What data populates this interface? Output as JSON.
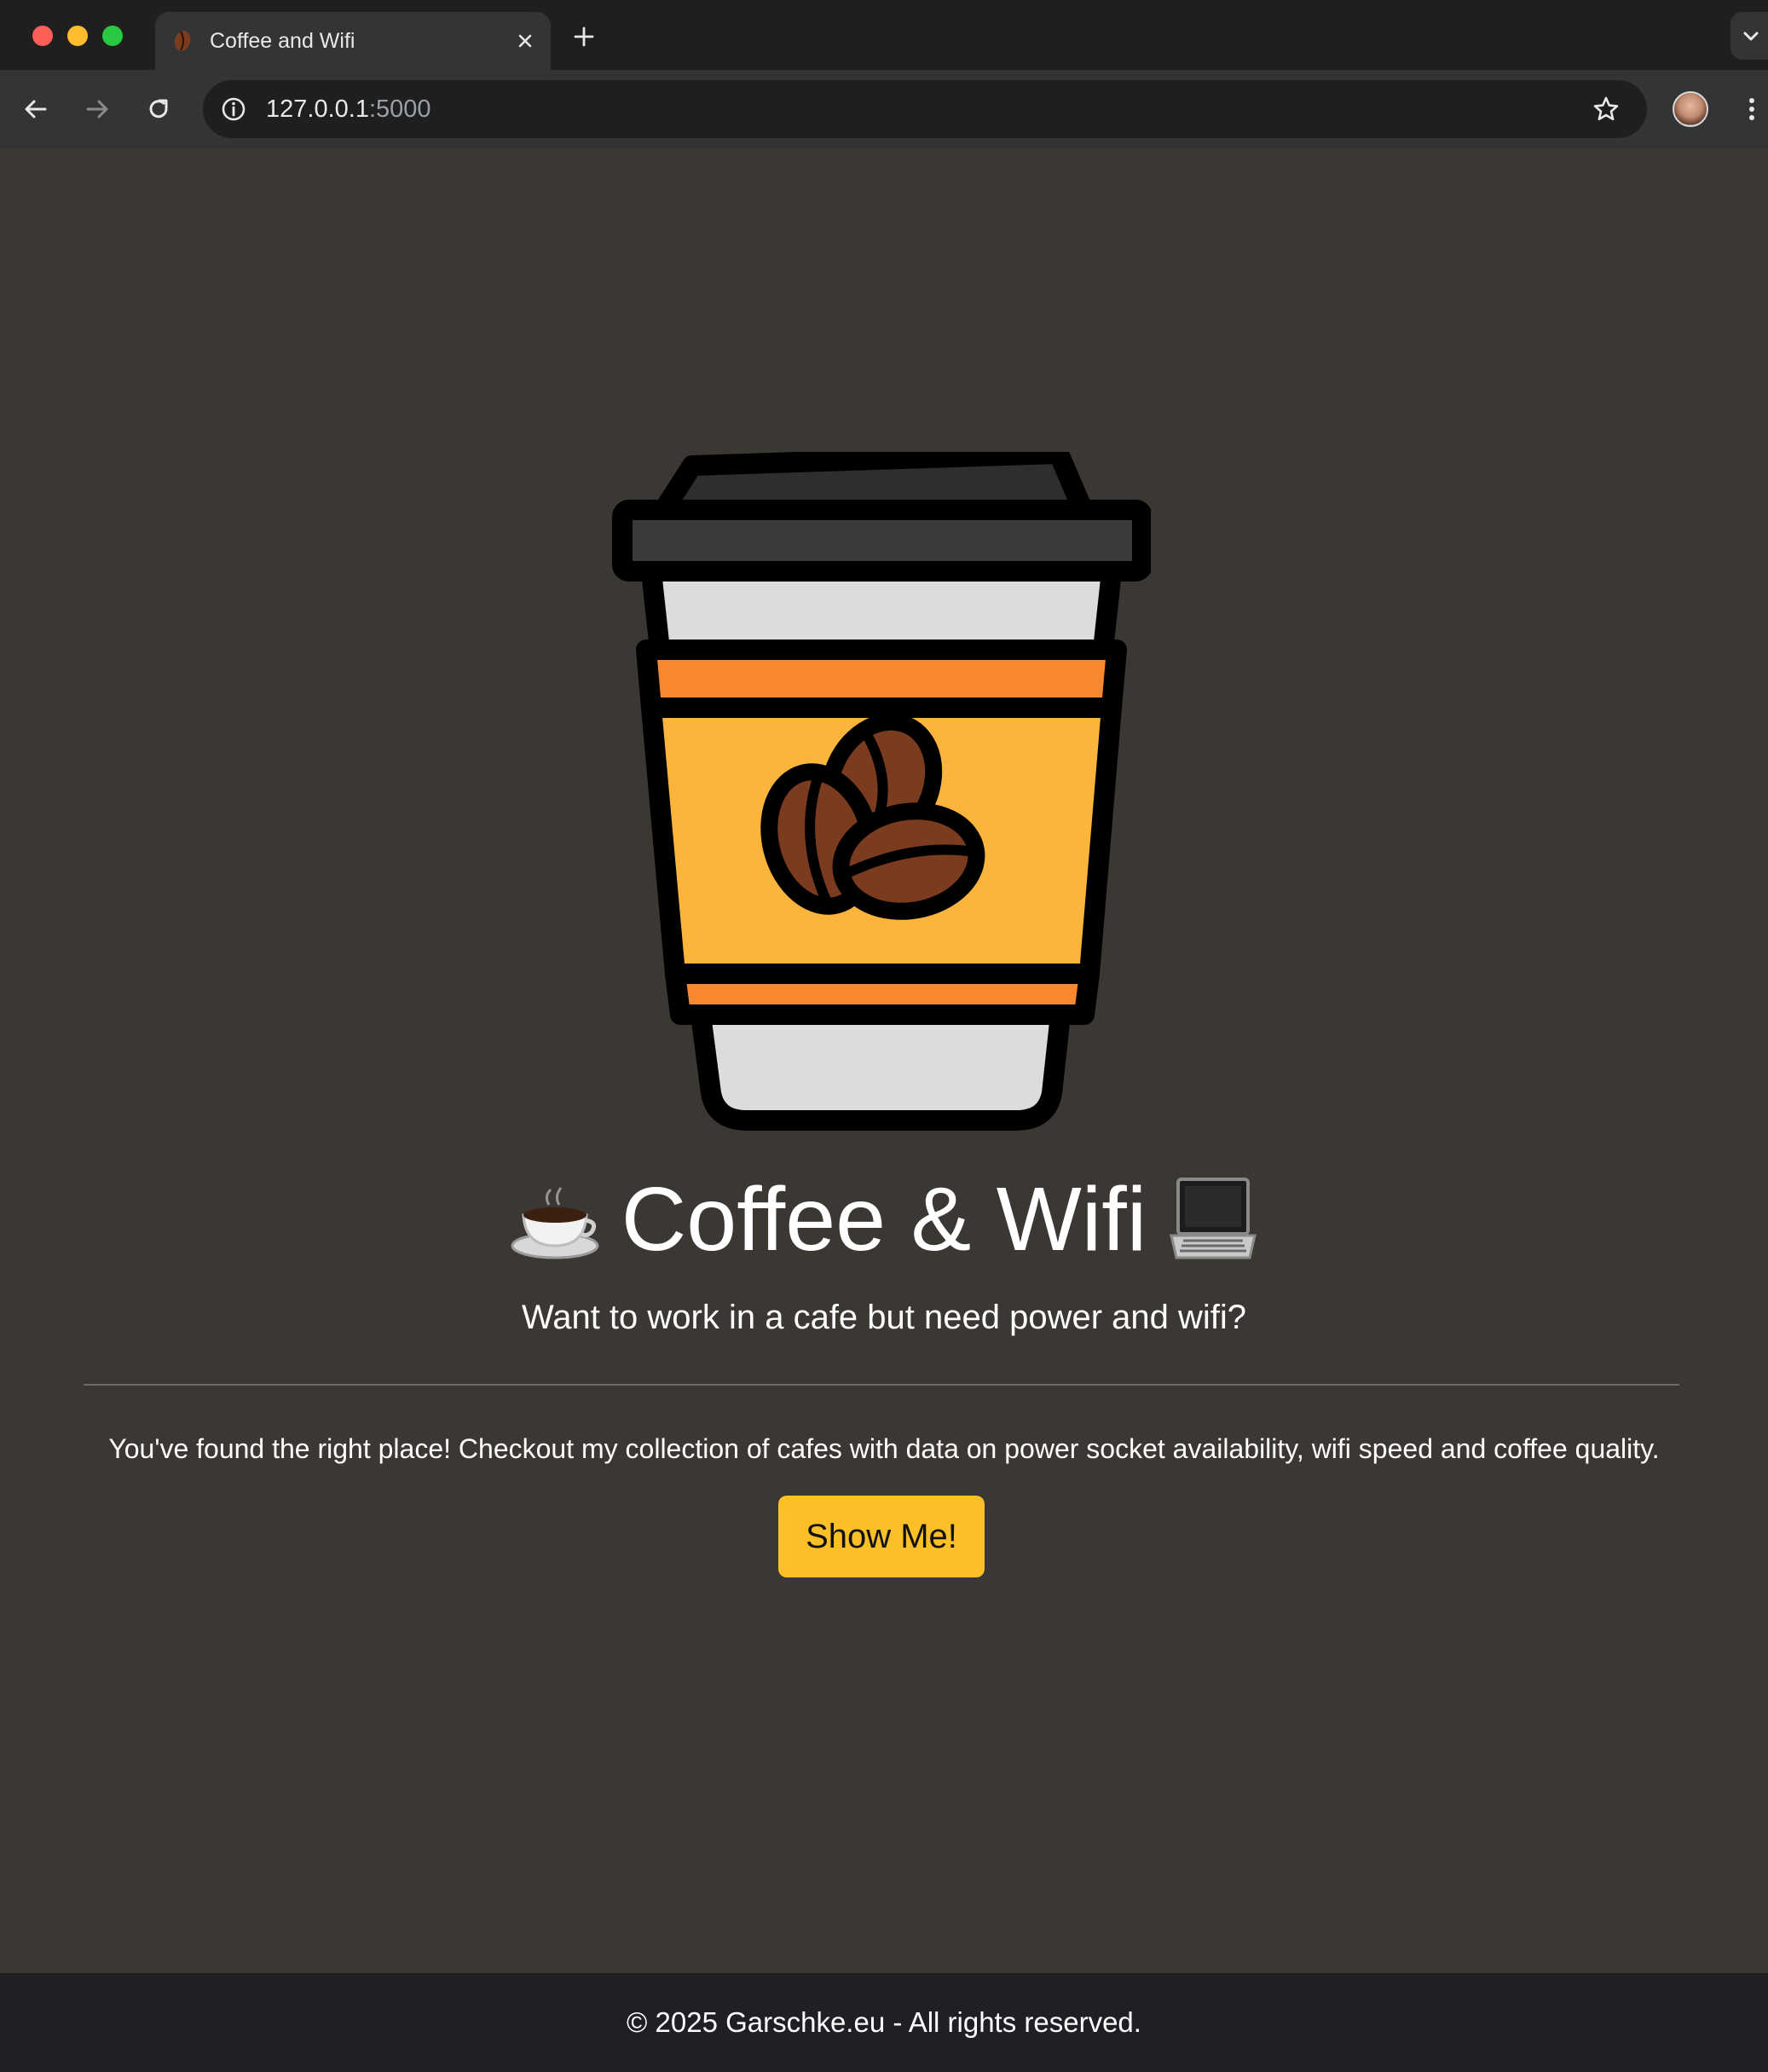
{
  "browser": {
    "tab_title": "Coffee and Wifi",
    "url_host": "127.0.0.1",
    "url_port": ":5000",
    "icons": {
      "back": "arrow-left-icon",
      "forward": "arrow-right-icon",
      "reload": "reload-icon",
      "info": "info-icon",
      "bookmark": "star-icon",
      "menu": "vertical-dots-icon",
      "new_tab": "plus-icon",
      "close_tab": "close-icon",
      "tab_search": "chevron-down-icon"
    }
  },
  "hero": {
    "image": "coffee-cup-logo",
    "title_left_emoji": "☕",
    "title": "Coffee & Wifi",
    "title_right_emoji": "💻",
    "subtitle": "Want to work in a cafe but need power and wifi?",
    "lead": "You've found the right place! Checkout my collection of cafes with data on power socket availability, wifi speed and coffee quality.",
    "cta_label": "Show Me!"
  },
  "footer": {
    "text": "© 2025 Garschke.eu - All rights reserved."
  },
  "colors": {
    "page_bg": "#3b3833",
    "button_bg": "#fbbf27",
    "footer_bg": "#1e2024",
    "cup_sleeve": "#fbb43c",
    "cup_band": "#f7882f",
    "bean": "#7a3b1f"
  }
}
